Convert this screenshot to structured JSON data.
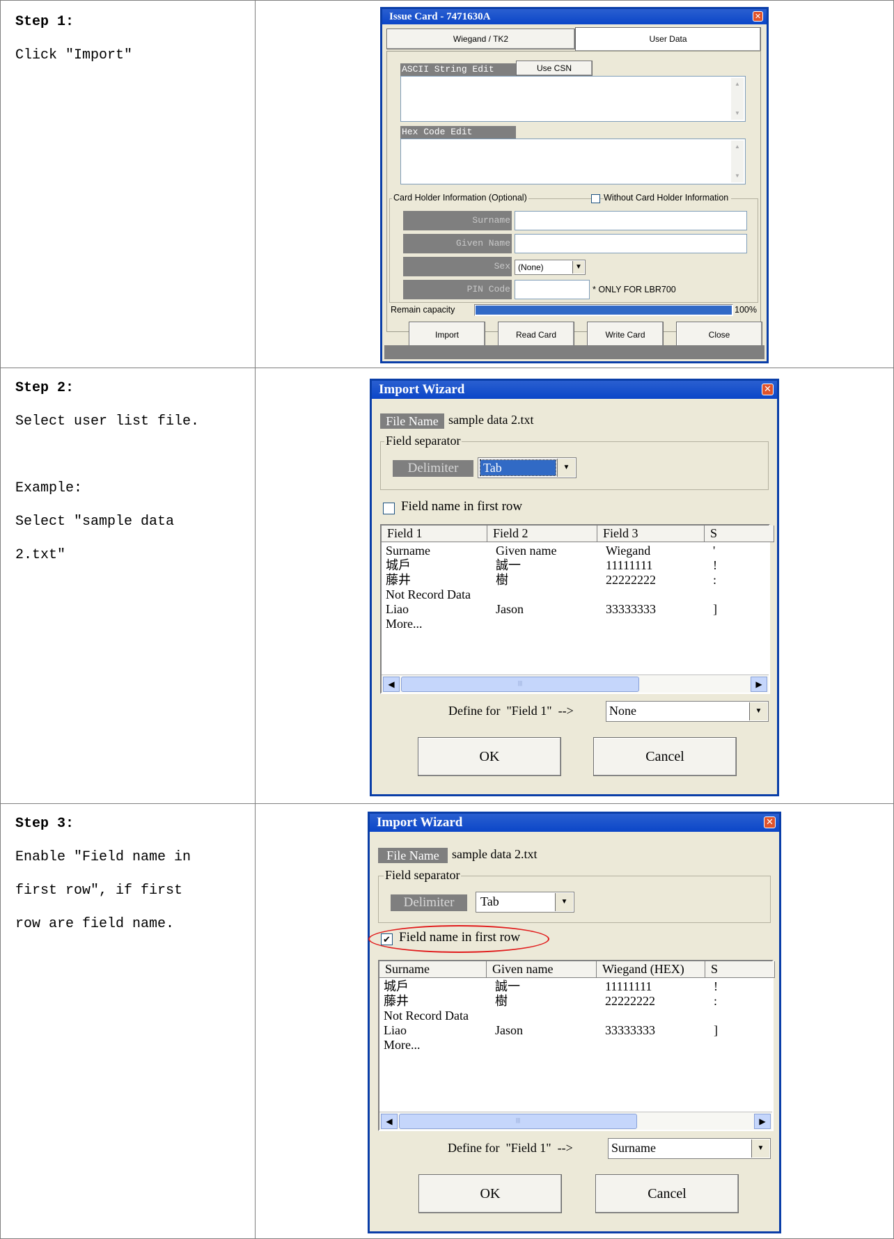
{
  "steps": [
    {
      "title": "Step 1:",
      "lines": [
        "Click \"Import\""
      ]
    },
    {
      "title": "Step 2:",
      "lines": [
        "Select user list file.",
        "",
        "Example:",
        "Select \"sample data",
        "2.txt\""
      ]
    },
    {
      "title": "Step 3:",
      "lines": [
        "Enable \"Field name in",
        "first row\", if first",
        "row are field name."
      ]
    }
  ],
  "issue_card": {
    "title": "Issue Card - 7471630A",
    "tabs": [
      "Wiegand / TK2",
      "User Data"
    ],
    "ascii_label": "ASCII String Edit",
    "use_csn": "Use CSN",
    "hex_label": "Hex Code Edit",
    "holder_group": "Card Holder Information (Optional)",
    "without_holder": "Without Card Holder Information",
    "surname": "Surname",
    "given_name": "Given Name",
    "sex": "Sex",
    "sex_value": "(None)",
    "pin": "PIN Code",
    "pin_note": "* ONLY FOR LBR700",
    "remain_label": "Remain capacity",
    "remain_value": "100%",
    "remain_fraction": 1.0,
    "buttons": [
      "Import",
      "Read Card",
      "Write Card",
      "Close"
    ]
  },
  "wizard2": {
    "title": "Import Wizard",
    "file_label": "File Name",
    "file_value": "sample data 2.txt",
    "sep_group": "Field separator",
    "delim_label": "Delimiter",
    "delim_value": "Tab",
    "first_row": "Field name in first row",
    "headers": [
      "Field 1",
      "Field 2",
      "Field 3",
      "S"
    ],
    "rows": [
      [
        "Surname",
        "Given name",
        "Wiegand",
        "'"
      ],
      [
        "城戶",
        "誠一",
        "11111111",
        "!"
      ],
      [
        "藤井",
        "樹",
        "22222222",
        ":"
      ],
      [
        "Not Record Data",
        "",
        "",
        ""
      ],
      [
        "Liao",
        "Jason",
        "33333333",
        "]"
      ],
      [
        "More...",
        "",
        "",
        ""
      ]
    ],
    "define_label": "Define for  \"Field 1\"  -->",
    "define_value": "None",
    "ok": "OK",
    "cancel": "Cancel"
  },
  "wizard3": {
    "title": "Import Wizard",
    "file_label": "File Name",
    "file_value": "sample data 2.txt",
    "sep_group": "Field separator",
    "delim_label": "Delimiter",
    "delim_value": "Tab",
    "first_row": "Field name in first row",
    "headers": [
      "Surname",
      "Given name",
      "Wiegand (HEX)",
      "S"
    ],
    "rows": [
      [
        "城戶",
        "誠一",
        "11111111",
        "!"
      ],
      [
        "藤井",
        "樹",
        "22222222",
        ":"
      ],
      [
        "Not Record Data",
        "",
        "",
        ""
      ],
      [
        "Liao",
        "Jason",
        "33333333",
        "]"
      ],
      [
        "More...",
        "",
        "",
        ""
      ]
    ],
    "define_label": "Define for  \"Field 1\"  -->",
    "define_value": "Surname",
    "ok": "OK",
    "cancel": "Cancel"
  }
}
